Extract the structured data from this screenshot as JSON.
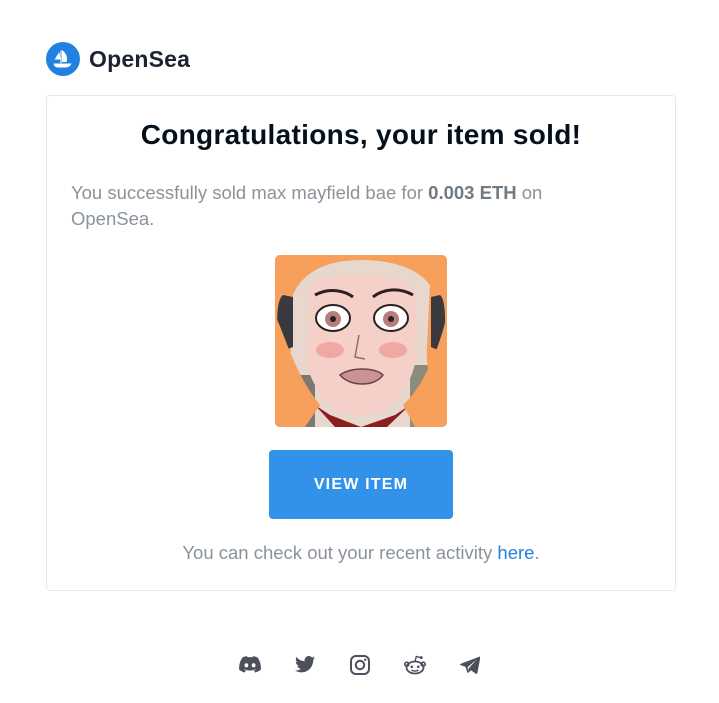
{
  "brand": {
    "name": "OpenSea",
    "accent": "#2081e2"
  },
  "email": {
    "title": "Congratulations, your item sold!",
    "message_prefix": "You successfully sold ",
    "item_name": "max mayfield bae",
    "message_mid": " for ",
    "price": "0.003 ETH",
    "message_suffix": " on OpenSea.",
    "view_button_label": "VIEW ITEM",
    "activity_prefix": "You can check out your recent activity ",
    "activity_link": "here",
    "activity_suffix": "."
  },
  "socials": [
    "discord-icon",
    "twitter-icon",
    "instagram-icon",
    "reddit-icon",
    "telegram-icon"
  ]
}
